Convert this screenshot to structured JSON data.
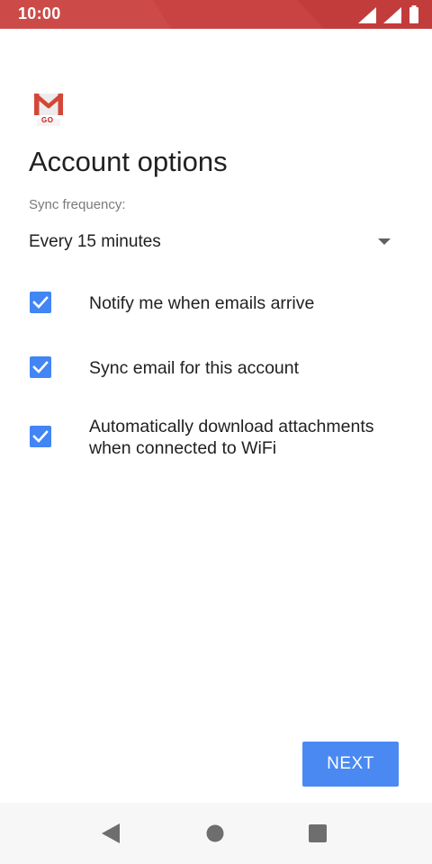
{
  "status_bar": {
    "time": "10:00",
    "background_color": "#cc4b49",
    "icons": [
      "wifi-signal-icon",
      "cell-signal-icon",
      "battery-icon"
    ]
  },
  "app": {
    "logo_icon": "gmail-go-logo-icon",
    "logo_text": "GO"
  },
  "page": {
    "title": "Account options"
  },
  "sync": {
    "label": "Sync frequency:",
    "selected_value": "Every 15 minutes",
    "dropdown_icon": "dropdown-arrow-icon"
  },
  "options": [
    {
      "label": "Notify me when emails arrive",
      "checked": true
    },
    {
      "label": "Sync email for this account",
      "checked": true
    },
    {
      "label": "Automatically download attachments when connected to WiFi",
      "checked": true
    }
  ],
  "actions": {
    "next_label": "NEXT",
    "accent_color": "#4285f4"
  },
  "nav_bar": {
    "icons": [
      "back-icon",
      "home-icon",
      "recents-icon"
    ]
  }
}
